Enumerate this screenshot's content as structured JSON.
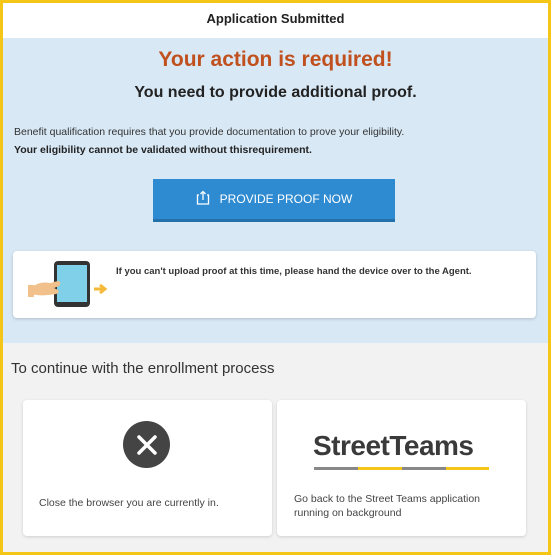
{
  "header": {
    "title": "Application Submitted"
  },
  "alert": {
    "headline": "Your action is required!",
    "subheadline": "You need to provide additional proof.",
    "description": "Benefit qualification requires that you provide documentation to prove your eligibility.",
    "description_bold": "Your eligibility cannot be validated without thisrequirement."
  },
  "proof_button": {
    "label": "PROVIDE PROOF NOW",
    "icon": "upload-icon"
  },
  "agent_notice": {
    "text": "If you can't upload proof at this time, please hand the device over to the Agent.",
    "icon": "hand-over-tablet-icon"
  },
  "continue_section": {
    "title": "To continue with the enrollment process",
    "close_card": {
      "icon": "close-icon",
      "text": "Close the browser you are currently in."
    },
    "app_card": {
      "logo": "StreetTeams",
      "text": "Go back to the Street Teams application running on background"
    }
  },
  "colors": {
    "accent_blue": "#2f8bd1",
    "alert_orange": "#c0501d",
    "panel_blue": "#d8e8f5",
    "frame_yellow": "#f5c518"
  }
}
